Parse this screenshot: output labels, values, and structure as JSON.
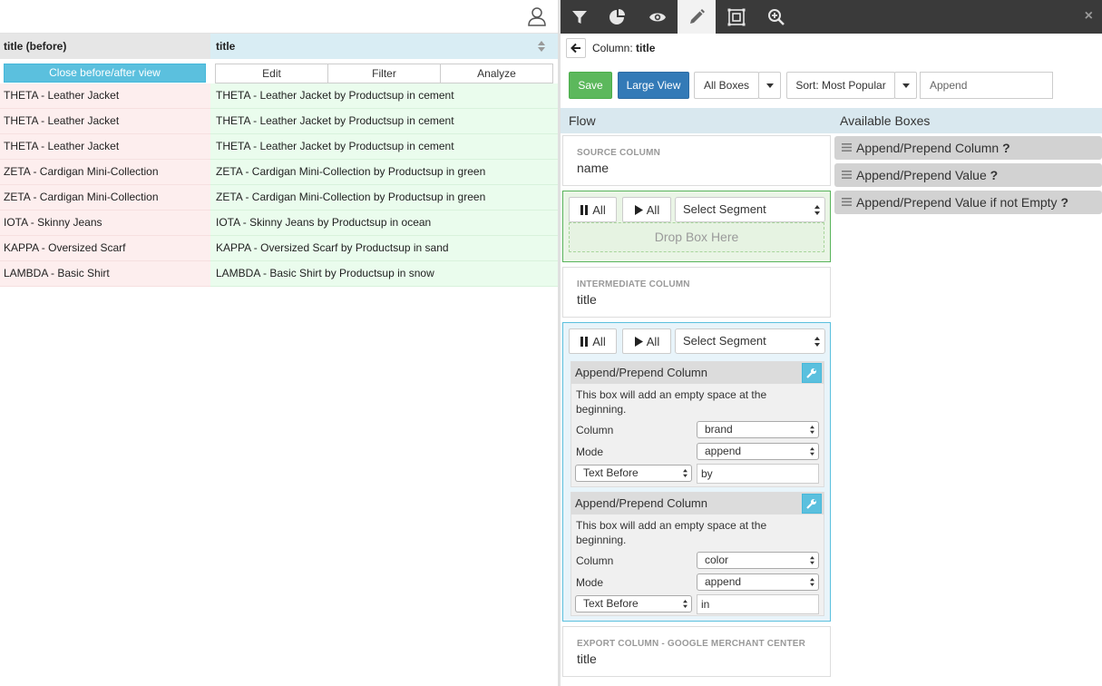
{
  "left": {
    "headers": {
      "before": "title (before)",
      "after": "title"
    },
    "close_button": "Close before/after view",
    "segment_buttons": [
      "Edit",
      "Filter",
      "Analyze"
    ],
    "rows": [
      {
        "before": "THETA - Leather Jacket",
        "after": "THETA - Leather Jacket by Productsup in cement"
      },
      {
        "before": "THETA - Leather Jacket",
        "after": "THETA - Leather Jacket by Productsup in cement"
      },
      {
        "before": "THETA - Leather Jacket",
        "after": "THETA - Leather Jacket by Productsup in cement"
      },
      {
        "before": "ZETA - Cardigan Mini-Collection",
        "after": "ZETA - Cardigan Mini-Collection by Productsup in green"
      },
      {
        "before": "ZETA - Cardigan Mini-Collection",
        "after": "ZETA - Cardigan Mini-Collection by Productsup in green"
      },
      {
        "before": "IOTA - Skinny Jeans",
        "after": "IOTA - Skinny Jeans by Productsup in ocean"
      },
      {
        "before": "KAPPA - Oversized Scarf",
        "after": "KAPPA - Oversized Scarf by Productsup in sand"
      },
      {
        "before": "LAMBDA - Basic Shirt",
        "after": "LAMBDA - Basic Shirt by Productsup in snow"
      }
    ]
  },
  "right": {
    "close": "×",
    "column_prefix": "Column:",
    "column_name": "title",
    "buttons": {
      "save": "Save",
      "large_view": "Large View",
      "all_boxes": "All Boxes",
      "sort": "Sort: Most Popular",
      "append_placeholder": "Append"
    },
    "flow_title": "Flow",
    "available_title": "Available Boxes",
    "source": {
      "label": "SOURCE COLUMN",
      "value": "name"
    },
    "stage1": {
      "pause": "All",
      "play": "All",
      "segment": "Select Segment",
      "drop": "Drop Box Here"
    },
    "intermediate": {
      "label": "INTERMEDIATE COLUMN",
      "value": "title"
    },
    "stage2": {
      "pause": "All",
      "play": "All",
      "segment": "Select Segment",
      "boxes": [
        {
          "title": "Append/Prepend Column",
          "desc": "This box will add an empty space at the beginning.",
          "column_label": "Column",
          "column": "brand",
          "mode_label": "Mode",
          "mode": "append",
          "position": "Text Before",
          "text": "by"
        },
        {
          "title": "Append/Prepend Column",
          "desc": "This box will add an empty space at the beginning.",
          "column_label": "Column",
          "column": "color",
          "mode_label": "Mode",
          "mode": "append",
          "position": "Text Before",
          "text": "in"
        }
      ]
    },
    "export": {
      "label": "EXPORT COLUMN - GOOGLE MERCHANT CENTER",
      "value": "title"
    },
    "available_boxes": [
      {
        "label": "Append/Prepend Column",
        "help": "?"
      },
      {
        "label": "Append/Prepend Value",
        "help": "?"
      },
      {
        "label": "Append/Prepend Value if not Empty",
        "help": "?"
      }
    ]
  }
}
